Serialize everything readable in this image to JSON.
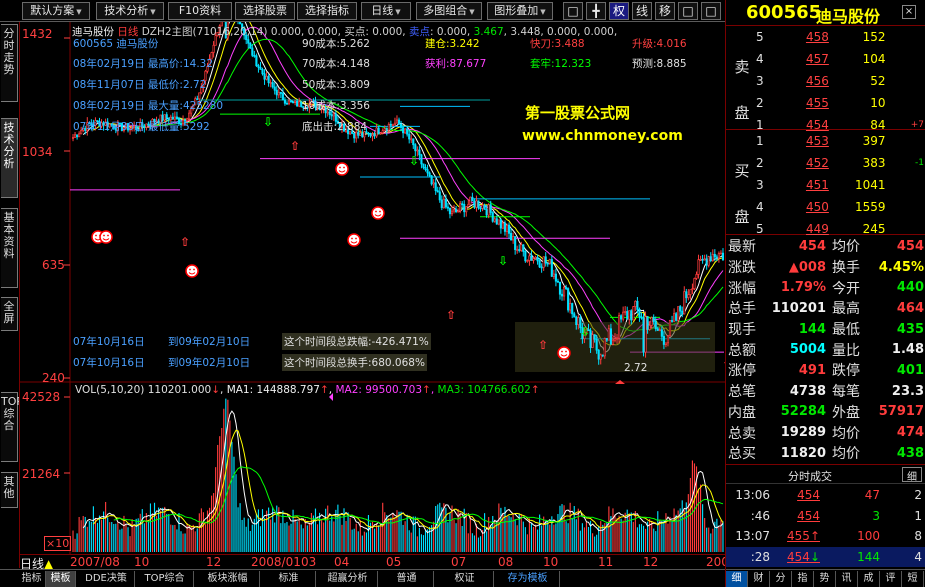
{
  "toolbar": {
    "items": [
      "默认方案",
      "技术分析",
      "F10资料",
      "选择股票",
      "选择指标",
      "日线",
      "多图组合",
      "图形叠加"
    ],
    "icons": [
      "□",
      "╋",
      "权",
      "线",
      "移",
      "□",
      "□"
    ],
    "stock_code": "600565",
    "stock_name": "迪马股份"
  },
  "left_tabs": [
    "分时走势",
    "技术分析",
    "基本资料",
    "全屏",
    "TOP综合",
    "其他"
  ],
  "chart": {
    "title_line": "迪马股份 日线 DZH2主图(71016,20,14) 0.000, 0.000, 买点: 0.000, 卖点: 0.000, 3.467, 3.448, 0.000, 0.000, ",
    "title_stock": "迪马股份",
    "title_period": "日线",
    "stats": {
      "code_name": "600565 迪马股份",
      "l1": "08年02月19日  最高价:14.32",
      "l2": "08年11月07日  最低价:2.72",
      "l3": "08年02月19日  最大量:425280",
      "l4": "07年11月30日  最低量:5292"
    },
    "cost_labels": [
      "90成本:5.262",
      "70成本:4.148",
      "50成本:3.809",
      "10成本:3.356",
      "底出击:2.884"
    ],
    "jiancang": "建仓:3.242",
    "kuaidao": "快刀:3.488",
    "shengji": "升级:4.016",
    "huoli": "获利:87.677",
    "taolao": "套牢:12.323",
    "yuce": "预测:8.885",
    "wm1": "第一股票公式网",
    "wm2": "www.chnmoney.com",
    "seg1a": "07年10月16日",
    "seg1b": "到09年02月10日",
    "seg1c": "这个时间段总跌幅:-426.471%",
    "seg2a": "07年10月16日",
    "seg2b": "到09年02月10日",
    "seg2c": "这个时间段总换手:680.068%",
    "low_label": "2.72",
    "price_axis": [
      "1432",
      "1034",
      "635",
      "240"
    ],
    "vol_line": "VOL(5,10,20)  110201.000↓, MA1: 144888.797↑, MA2: 99500.703↑, MA3: 104766.602↑",
    "vol_axis": [
      "42528",
      "21264"
    ],
    "x10": "×10",
    "date_axis": [
      "2007/08",
      "10",
      "12",
      "2008/01",
      "03",
      "04",
      "05",
      "07",
      "08",
      "10",
      "11",
      "12",
      "2009/01"
    ],
    "period_label": "日线"
  },
  "chart_data": {
    "type": "candlestick",
    "price_ylim": [
      2.4,
      14.32
    ],
    "dates": [
      "2007-08",
      "2007-10",
      "2007-12",
      "2008-01",
      "2008-03",
      "2008-04",
      "2008-05",
      "2008-07",
      "2008-08",
      "2008-10",
      "2008-11",
      "2008-12",
      "2009-01"
    ],
    "approx_close": [
      8.5,
      9.3,
      9.0,
      12.8,
      10.5,
      9.0,
      8.8,
      5.8,
      5.5,
      3.6,
      2.9,
      3.4,
      4.5
    ],
    "highest": {
      "date": "08年02月19日",
      "value": 14.32
    },
    "lowest": {
      "date": "08年11月07日",
      "value": 2.72
    },
    "volume_ylim": [
      0,
      42528
    ]
  },
  "right_panel": {
    "code": "600565",
    "name": "迪马股份",
    "sell_label": "卖盘",
    "buy_label": "买盘",
    "sells": [
      {
        "n": "5",
        "p": "458",
        "v": "152",
        "c": ""
      },
      {
        "n": "4",
        "p": "457",
        "v": "104",
        "c": ""
      },
      {
        "n": "3",
        "p": "456",
        "v": "52",
        "c": ""
      },
      {
        "n": "2",
        "p": "455",
        "v": "10",
        "c": ""
      },
      {
        "n": "1",
        "p": "454",
        "v": "84",
        "c": "+7"
      }
    ],
    "buys": [
      {
        "n": "1",
        "p": "453",
        "v": "397",
        "c": ""
      },
      {
        "n": "2",
        "p": "452",
        "v": "383",
        "c": "-1"
      },
      {
        "n": "3",
        "p": "451",
        "v": "1041",
        "c": ""
      },
      {
        "n": "4",
        "p": "450",
        "v": "1559",
        "c": ""
      },
      {
        "n": "5",
        "p": "449",
        "v": "245",
        "c": ""
      }
    ],
    "quote": [
      {
        "k1": "最新",
        "v1": "454",
        "k2": "均价",
        "v2": "454",
        "c1": "red",
        "c2": "red"
      },
      {
        "k1": "涨跌",
        "v1": "▲008",
        "k2": "换手",
        "v2": "4.45%",
        "c1": "red",
        "c2": "yel"
      },
      {
        "k1": "涨幅",
        "v1": "1.79%",
        "k2": "今开",
        "v2": "440",
        "c1": "red",
        "c2": "grn"
      },
      {
        "k1": "总手",
        "v1": "110201",
        "k2": "最高",
        "v2": "464",
        "c1": "wht",
        "c2": "red"
      },
      {
        "k1": "现手",
        "v1": "144",
        "k2": "最低",
        "v2": "435",
        "c1": "grn",
        "c2": "grn"
      },
      {
        "k1": "总额",
        "v1": "5004",
        "k2": "量比",
        "v2": "1.48",
        "c1": "cya",
        "c2": "wht"
      },
      {
        "k1": "涨停",
        "v1": "491",
        "k2": "跌停",
        "v2": "401",
        "c1": "red",
        "c2": "grn"
      },
      {
        "k1": "总笔",
        "v1": "4738",
        "k2": "每笔",
        "v2": "23.3",
        "c1": "wht",
        "c2": "wht"
      },
      {
        "k1": "内盘",
        "v1": "52284",
        "k2": "外盘",
        "v2": "57917",
        "c1": "grn",
        "c2": "red"
      },
      {
        "k1": "总卖",
        "v1": "19289",
        "k2": "均价",
        "v2": "474",
        "c1": "wht",
        "c2": "red"
      },
      {
        "k1": "总买",
        "v1": "11820",
        "k2": "均价",
        "v2": "438",
        "c1": "wht",
        "c2": "grn"
      }
    ],
    "trade_title": "分时成交",
    "trade_btn": "细",
    "trades": [
      {
        "t": "13:06",
        "p": "454",
        "d": "",
        "v": "47",
        "n": "2",
        "pc": "red",
        "vc": "red"
      },
      {
        "t": ":46",
        "p": "454",
        "d": "",
        "v": "3",
        "n": "1",
        "pc": "red",
        "vc": "grn"
      },
      {
        "t": "13:07",
        "p": "455",
        "d": "↑",
        "v": "100",
        "n": "8",
        "pc": "red",
        "vc": "red"
      },
      {
        "t": ":28",
        "p": "454",
        "d": "↓",
        "v": "144",
        "n": "4",
        "pc": "red",
        "vc": "grn"
      }
    ],
    "bottom_tabs": [
      "细",
      "财",
      "分",
      "指",
      "势",
      "讯",
      "成",
      "评",
      "短"
    ]
  },
  "bottom_bar": {
    "tabs": [
      "指标",
      "模板",
      "DDE决策",
      "TOP综合",
      "板块涨幅",
      "标准",
      "超赢分析",
      "普通",
      "权证",
      "存为模板"
    ]
  }
}
